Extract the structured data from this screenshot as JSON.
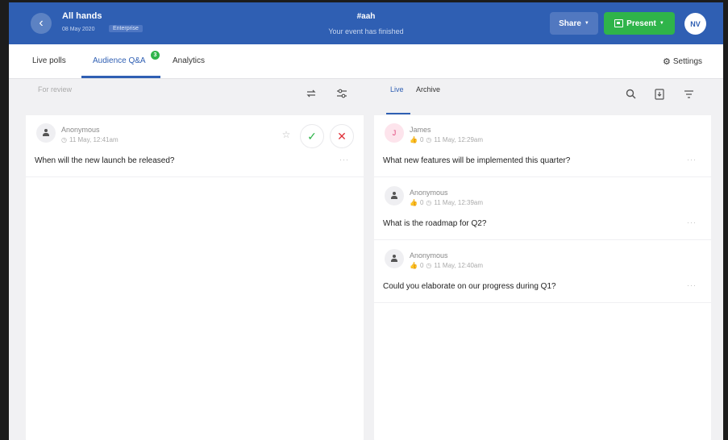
{
  "header": {
    "back_label": "‹",
    "event_name": "All hands",
    "event_date": "08 May 2020",
    "badge": "Enterprise",
    "event_code": "#aah",
    "status": "Your event has finished",
    "share_label": "Share",
    "present_label": "Present",
    "avatar_initials": "NV"
  },
  "tabs": [
    {
      "label": "Live polls"
    },
    {
      "label": "Audience Q&A",
      "count": "3"
    },
    {
      "label": "Analytics"
    }
  ],
  "settings_label": "Settings",
  "review": {
    "heading": "For review",
    "questions": [
      {
        "author": "Anonymous",
        "time": "11 May, 12:41am",
        "text": "When will the new launch be released?",
        "more": "···"
      }
    ]
  },
  "live": {
    "tab_live": "Live",
    "tab_archive": "Archive",
    "questions": [
      {
        "initial": "J",
        "author": "James",
        "votes": "0",
        "time": "11 May, 12:29am",
        "text": "What new features will be implemented this quarter?",
        "more": "···"
      },
      {
        "author": "Anonymous",
        "votes": "0",
        "time": "11 May, 12:39am",
        "text": "What is the roadmap for Q2?",
        "more": "···"
      },
      {
        "author": "Anonymous",
        "votes": "0",
        "time": "11 May, 12:40am",
        "text": "Could you elaborate on our progress during Q1?",
        "more": "···"
      }
    ]
  },
  "colors": {
    "brand": "#2f5fb3",
    "present": "#2fb44a",
    "approve": "#2fb44a",
    "reject": "#e0323a"
  }
}
